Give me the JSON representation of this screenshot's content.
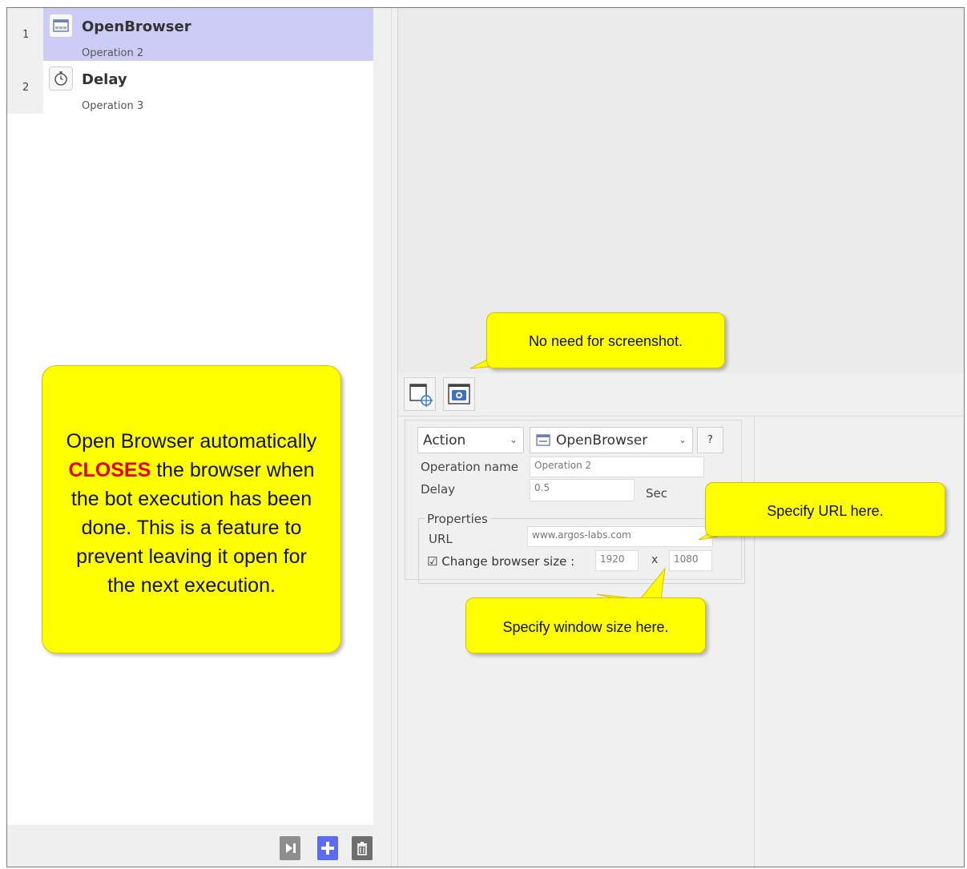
{
  "operations": [
    {
      "index": "1",
      "title": "OpenBrowser",
      "subtitle": "Operation 2",
      "icon": "browser-www-icon",
      "selected": true
    },
    {
      "index": "2",
      "title": "Delay",
      "subtitle": "Operation 3",
      "icon": "stopwatch-icon",
      "selected": false
    }
  ],
  "toolbar": {
    "buttons": [
      "step-next-icon",
      "add-icon",
      "trash-icon"
    ],
    "colors": {
      "next": "#8e8e8e",
      "add": "#5b6cf0",
      "delete": "#6e6e6e"
    }
  },
  "properties_panel": {
    "tool_buttons": [
      "capture-window-icon",
      "screenshot-camera-icon"
    ],
    "type_select": "Action",
    "plugin_select": "OpenBrowser",
    "help_label": "?",
    "operation_name_label": "Operation name",
    "operation_name_value": "Operation 2",
    "delay_label": "Delay",
    "delay_value": "0.5",
    "delay_unit": "Sec",
    "properties_group_title": "Properties",
    "url_label": "URL",
    "url_value": "www.argos-labs.com",
    "change_size_label": "Change browser size :",
    "change_size_checked": true,
    "width_value": "1920",
    "size_separator": "x",
    "height_value": "1080"
  },
  "callouts": {
    "screenshot": "No need for screenshot.",
    "url": "Specify URL here.",
    "window_size": "Specify window size here.",
    "big_line1": "Open Browser automatically",
    "big_emphasis": "CLOSES",
    "big_line2": " the browser when",
    "big_line3": "the bot execution has been",
    "big_line4": "done. This is a feature to",
    "big_line5": "prevent leaving it open for",
    "big_line6": "the next execution."
  },
  "colors": {
    "selection": "#ccccf7",
    "callout_fill": "#ffff00",
    "emphasis": "#e00000"
  }
}
